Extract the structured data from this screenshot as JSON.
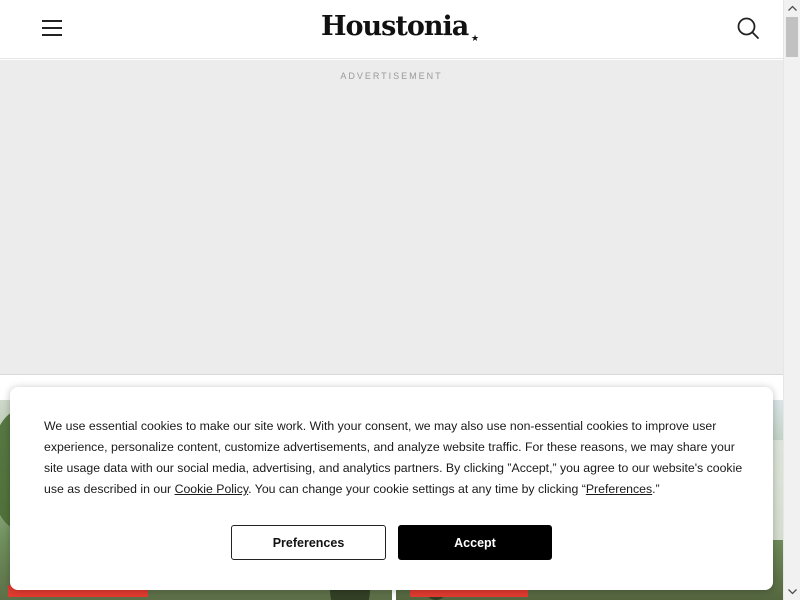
{
  "header": {
    "logo": "Houstonia",
    "logo_mark": "★"
  },
  "ad": {
    "label": "ADVERTISEMENT"
  },
  "cookie_banner": {
    "text_part1": "We use essential cookies to make our site work. With your consent, we may also use non-essential cookies to improve user experience, personalize content, customize advertisements, and analyze website traffic. For these reasons, we may share your site usage data with our social media, advertising, and analytics partners. By clicking ”Accept,” you agree to our website's cookie use as described in our ",
    "cookie_policy_link": "Cookie Policy",
    "text_part2": ". You can change your cookie settings at any time by clicking “",
    "preferences_link": "Preferences",
    "text_part3": ".”",
    "preferences_button": "Preferences",
    "accept_button": "Accept"
  },
  "colors": {
    "tag_red": "#e23b30",
    "accept_bg": "#000000"
  },
  "icons": {
    "menu": "hamburger-menu-icon",
    "search": "search-icon"
  }
}
